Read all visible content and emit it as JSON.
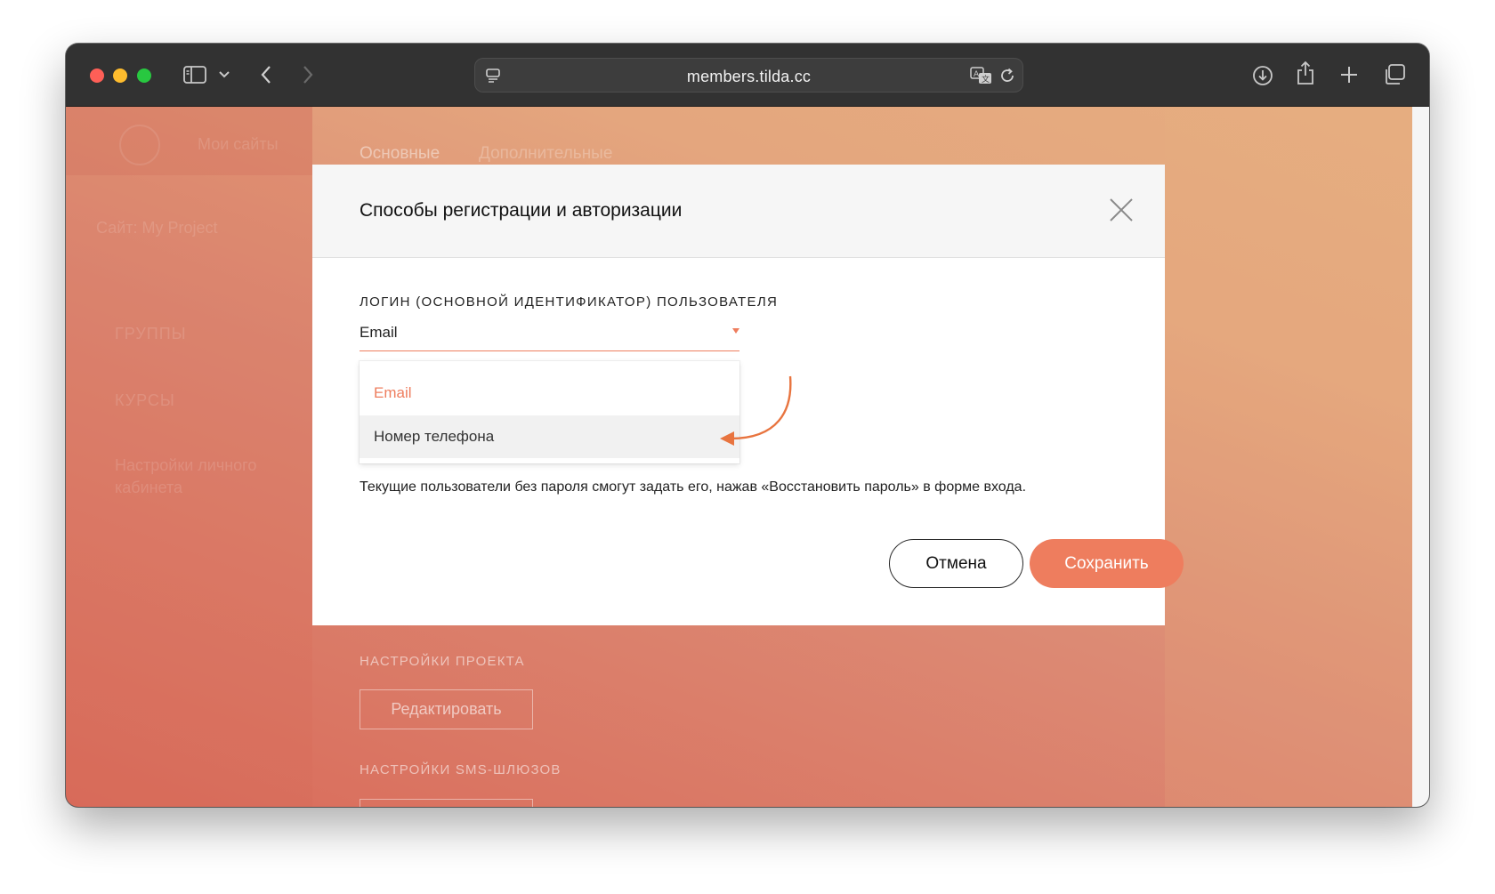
{
  "browser": {
    "url": "members.tilda.cc",
    "icons": [
      "sidebar-icon",
      "chevron-down-icon",
      "back-icon",
      "forward-icon",
      "page-settings-icon",
      "translate-icon",
      "reload-icon",
      "download-icon",
      "share-icon",
      "new-tab-icon",
      "tab-overview-icon"
    ]
  },
  "background_page": {
    "sidebar": {
      "logo_text": "Мои сайты",
      "project_title": "Сайт: My Project",
      "items": [
        "Группы",
        "Курсы",
        "Настройки личного кабинета"
      ]
    },
    "tabs": [
      "Основные",
      "Дополнительные"
    ],
    "sections": [
      {
        "label": "НАСТРОЙКИ ПРОЕКТА",
        "button": "Редактировать"
      },
      {
        "label": "НАСТРОЙКИ SMS-ШЛЮЗОВ"
      }
    ]
  },
  "modal": {
    "title": "Способы регистрации и авторизации",
    "field_label": "ЛОГИН (ОСНОВНОЙ ИДЕНТИФИКАТОР) ПОЛЬЗОВАТЕЛЯ",
    "select_value": "Email",
    "options": [
      "Email",
      "Номер телефона"
    ],
    "selected_option": "Email",
    "highlighted_option": "Номер телефона",
    "hint": "Текущие пользователи без пароля смогут задать его, нажав «Восстановить пароль» в форме входа.",
    "cancel_label": "Отмена",
    "save_label": "Сохранить"
  },
  "colors": {
    "accent": "#ee7d5e",
    "annotation_arrow": "#e8743f",
    "overlay_start": "#d96b5a",
    "overlay_end": "#e6ad80"
  }
}
